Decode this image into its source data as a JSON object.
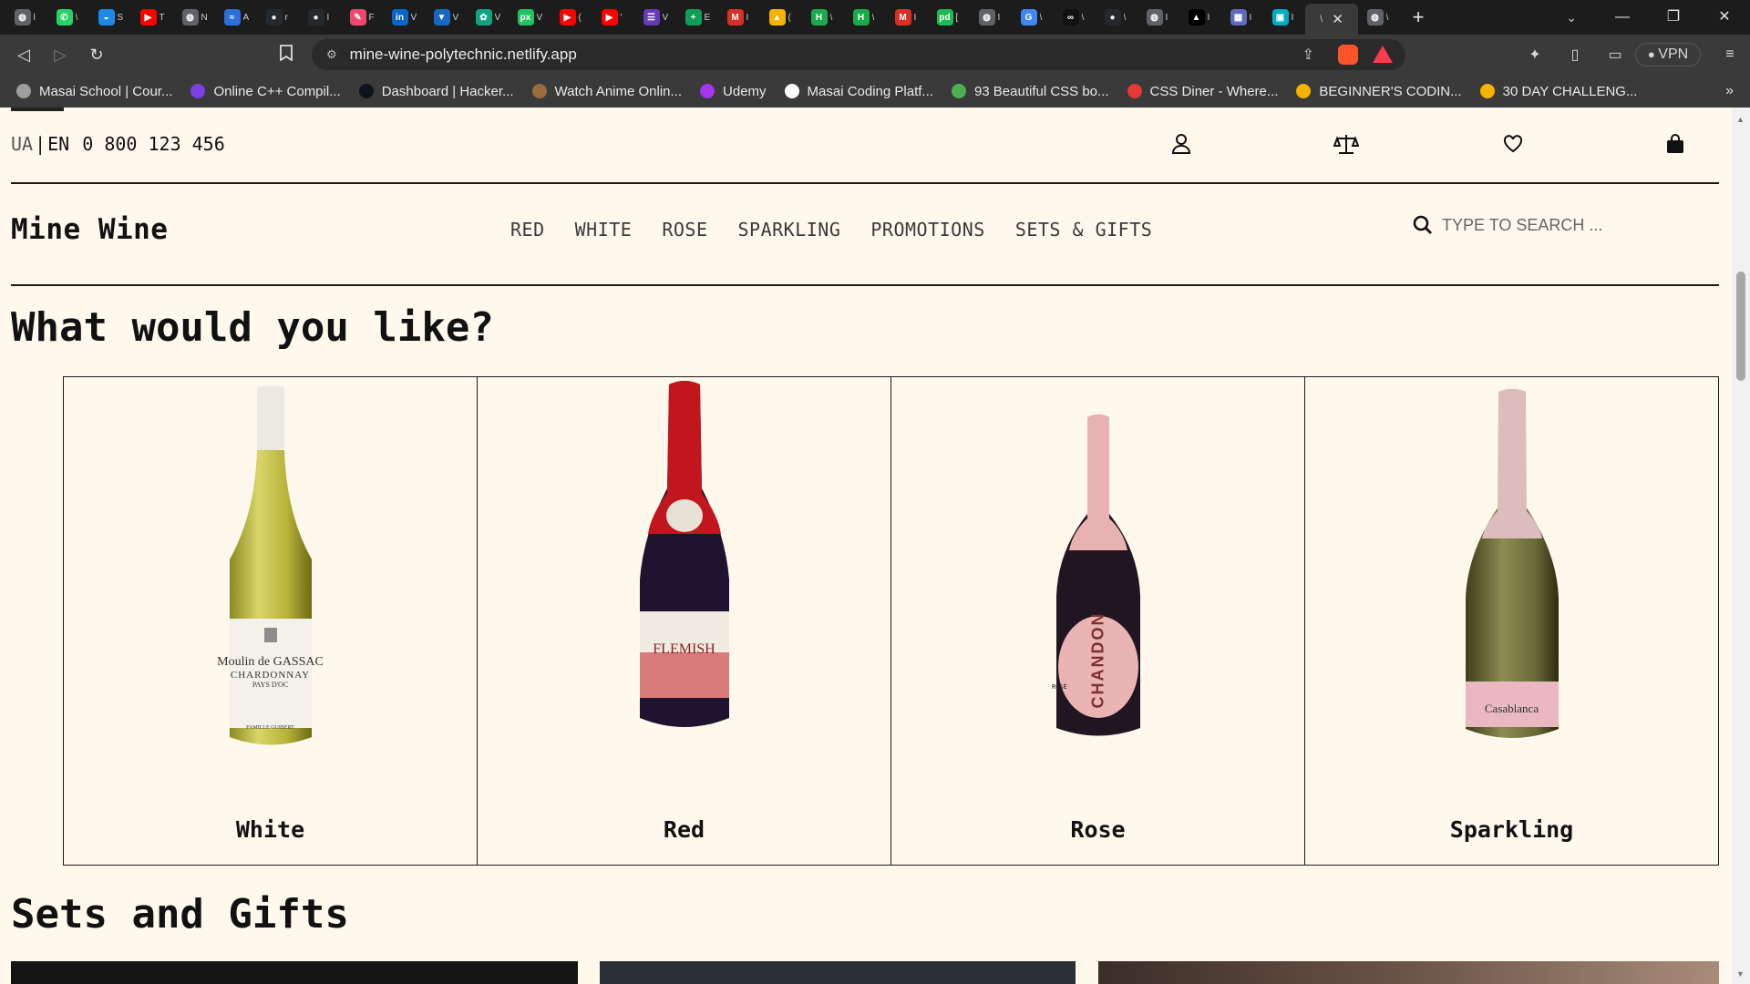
{
  "browser": {
    "tabs": [
      {
        "icon": "globe-icon",
        "color": "#5f6368",
        "glyph": "◍",
        "letter": "l"
      },
      {
        "icon": "whatsapp-icon",
        "color": "#25d366",
        "glyph": "✆",
        "letter": "\\"
      },
      {
        "icon": "edge-icon",
        "color": "#1e88e5",
        "glyph": "◒",
        "letter": "S"
      },
      {
        "icon": "youtube-icon",
        "color": "#ff0000",
        "glyph": "▶",
        "letter": "T"
      },
      {
        "icon": "globe-icon",
        "color": "#5f6368",
        "glyph": "◍",
        "letter": "N"
      },
      {
        "icon": "wave-icon",
        "color": "#2a6fdb",
        "glyph": "≈",
        "letter": "A"
      },
      {
        "icon": "github-icon",
        "color": "#24292e",
        "glyph": "●",
        "letter": "r"
      },
      {
        "icon": "github-icon",
        "color": "#24292e",
        "glyph": "●",
        "letter": "I"
      },
      {
        "icon": "pen-icon",
        "color": "#ef476f",
        "glyph": "✎",
        "letter": "F"
      },
      {
        "icon": "linkedin-icon",
        "color": "#0a66c2",
        "glyph": "in",
        "letter": "V"
      },
      {
        "icon": "vuetify-icon",
        "color": "#1867c0",
        "glyph": "▼",
        "letter": "V"
      },
      {
        "icon": "chatgpt-icon",
        "color": "#10a37f",
        "glyph": "✿",
        "letter": "V"
      },
      {
        "icon": "pixel-icon",
        "color": "#21c063",
        "glyph": "px",
        "letter": "V"
      },
      {
        "icon": "youtube-icon",
        "color": "#ff0000",
        "glyph": "▶",
        "letter": "("
      },
      {
        "icon": "youtube-icon",
        "color": "#ff0000",
        "glyph": "▶",
        "letter": "'"
      },
      {
        "icon": "forms-icon",
        "color": "#673ab7",
        "glyph": "☰",
        "letter": "V"
      },
      {
        "icon": "plus-sheet-icon",
        "color": "#0f9d58",
        "glyph": "+",
        "letter": "E"
      },
      {
        "icon": "gmail-icon",
        "color": "#d93025",
        "glyph": "M",
        "letter": "I"
      },
      {
        "icon": "drive-icon",
        "color": "#f4b400",
        "glyph": "▲",
        "letter": "("
      },
      {
        "icon": "hackerrank-icon",
        "color": "#1ba94c",
        "glyph": "H",
        "letter": "\\"
      },
      {
        "icon": "hackerrank-icon",
        "color": "#1ba94c",
        "glyph": "H",
        "letter": "\\"
      },
      {
        "icon": "gmail-icon",
        "color": "#d93025",
        "glyph": "M",
        "letter": "I"
      },
      {
        "icon": "pd-icon",
        "color": "#1db954",
        "glyph": "pd",
        "letter": "["
      },
      {
        "icon": "globe-icon",
        "color": "#5f6368",
        "glyph": "◍",
        "letter": "I"
      },
      {
        "icon": "google-icon",
        "color": "#4285f4",
        "glyph": "G",
        "letter": "\\"
      },
      {
        "icon": "infinity-icon",
        "color": "#111111",
        "glyph": "∞",
        "letter": "\\"
      },
      {
        "icon": "github-icon",
        "color": "#24292e",
        "glyph": "●",
        "letter": "\\"
      },
      {
        "icon": "globe-icon",
        "color": "#5f6368",
        "glyph": "◍",
        "letter": "I"
      },
      {
        "icon": "triangle-icon",
        "color": "#000000",
        "glyph": "▲",
        "letter": "I"
      },
      {
        "icon": "calendar-icon",
        "color": "#5c6bc0",
        "glyph": "▦",
        "letter": "I"
      },
      {
        "icon": "image-icon",
        "color": "#00acc1",
        "glyph": "▣",
        "letter": "I"
      }
    ],
    "active_tab": {
      "icon": "netlify-icon",
      "letter": "\\"
    },
    "after_tab": {
      "icon": "globe-icon",
      "letter": "\\"
    },
    "url": "mine-wine-polytechnic.netlify.app",
    "vpn_label": "VPN",
    "bookmarks": [
      {
        "icon": "globe-icon",
        "color": "#9e9e9e",
        "label": "Masai School | Cour..."
      },
      {
        "icon": "bolt-icon",
        "color": "#7b3fe4",
        "label": "Online C++ Compil..."
      },
      {
        "icon": "hackerrank-icon",
        "color": "#0e141e",
        "label": "Dashboard | Hacker..."
      },
      {
        "icon": "anime-icon",
        "color": "#9c6b3c",
        "label": "Watch Anime Onlin..."
      },
      {
        "icon": "udemy-icon",
        "color": "#a435f0",
        "label": "Udemy"
      },
      {
        "icon": "masai-icon",
        "color": "#ffffff",
        "label": "Masai Coding Platf..."
      },
      {
        "icon": "css-icon",
        "color": "#4caf50",
        "label": "93 Beautiful CSS bo..."
      },
      {
        "icon": "css-diner-icon",
        "color": "#e53935",
        "label": "CSS Diner - Where..."
      },
      {
        "icon": "drive-icon",
        "color": "#f4b400",
        "label": "BEGINNER'S CODIN..."
      },
      {
        "icon": "drive-icon",
        "color": "#f4b400",
        "label": "30 DAY CHALLENG..."
      }
    ]
  },
  "site": {
    "lang": {
      "ua": "UA",
      "sep": "|",
      "en": "EN"
    },
    "phone": "0 800 123 456",
    "logo": "Mine Wine",
    "nav": [
      "RED",
      "WHITE",
      "ROSE",
      "SPARKLING",
      "PROMOTIONS",
      "SETS & GIFTS"
    ],
    "search_placeholder": "TYPE TO SEARCH ...",
    "heading_categories": "What would you like?",
    "categories": [
      {
        "label": "White",
        "bottle_label_line1": "Moulin de GASSAC",
        "bottle_label_line2": "CHARDONNAY",
        "bottle_label_line3": "PAYS D'OC",
        "bottle_label_line4": "FAMILLE GUIBERT"
      },
      {
        "label": "Red",
        "bottle_label_line1": "FLEMISH"
      },
      {
        "label": "Rose",
        "bottle_label_line1": "CHANDON",
        "bottle_label_line2": "ROSÉ"
      },
      {
        "label": "Sparkling",
        "bottle_label_line1": "Casablanca"
      }
    ],
    "heading_sets": "Sets and Gifts"
  }
}
